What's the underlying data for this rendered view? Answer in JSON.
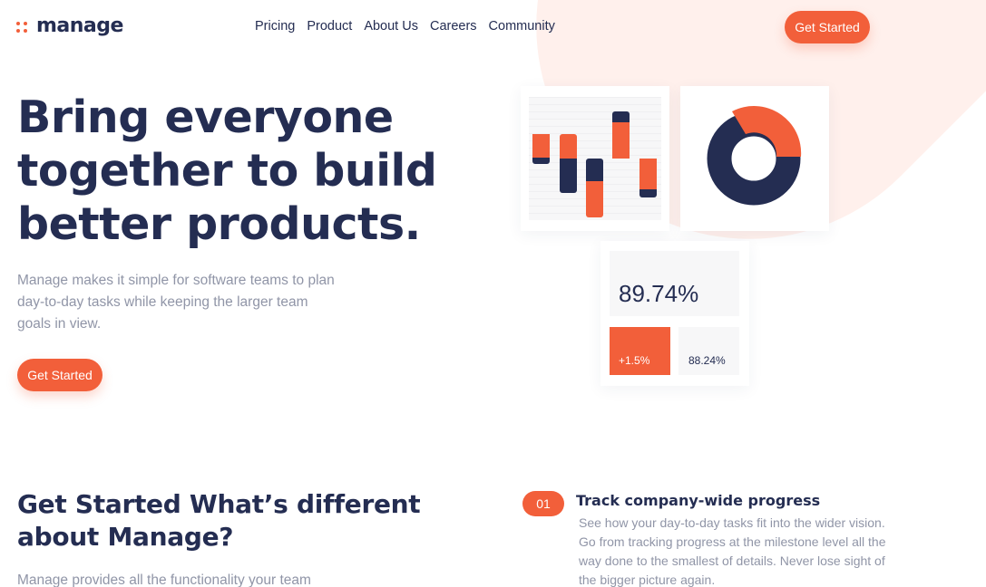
{
  "brand": {
    "name": "manage",
    "accent": "#f25f3a",
    "navy": "#242d52",
    "muted": "#9095a7",
    "tint": "#fff0ec"
  },
  "nav": {
    "items": [
      "Pricing",
      "Product",
      "About Us",
      "Careers",
      "Community"
    ],
    "cta_label": "Get Started"
  },
  "hero": {
    "title": "Bring everyone together to build better products.",
    "description": "Manage makes it simple for software teams to plan day-to-day tasks while keeping the larger team goals in view.",
    "cta_label": "Get Started"
  },
  "illustration": {
    "stat_main": "89.74%",
    "stat_change": "+1.5%",
    "stat_secondary": "88.24%"
  },
  "features_section": {
    "title": "Get Started What’s different about Manage?",
    "description": "Manage provides all the functionality your team",
    "items": [
      {
        "number": "01",
        "title": "Track company-wide progress",
        "description": "See how your day-to-day tasks fit into the wider vision. Go from tracking progress at the milestone level all the way done to the smallest of details. Never lose sight of the bigger picture again."
      }
    ]
  }
}
